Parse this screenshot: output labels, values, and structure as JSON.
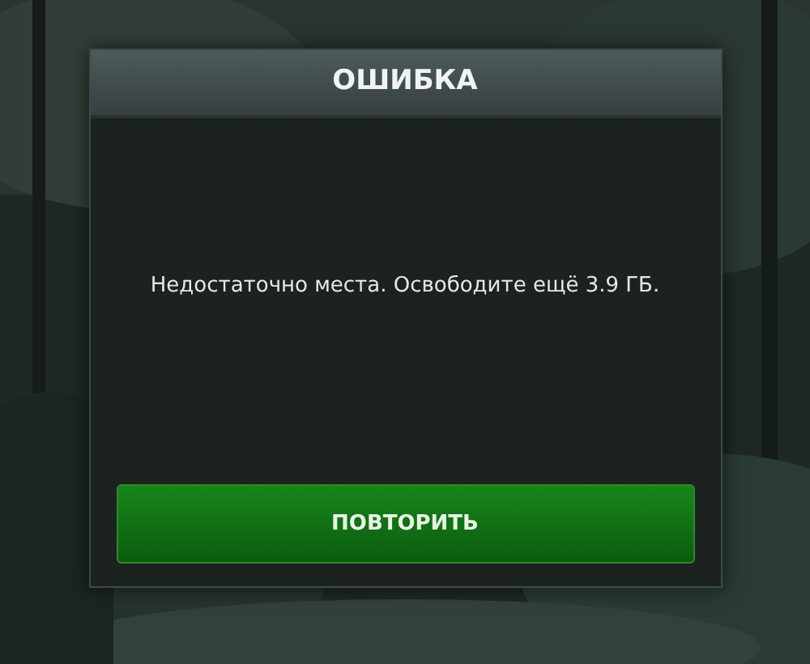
{
  "dialog": {
    "title": "ОШИБКА",
    "message": "Недостаточно места. Освободите ещё 3.9 ГБ.",
    "buttons": [
      "ПОВТОРИТЬ"
    ]
  }
}
